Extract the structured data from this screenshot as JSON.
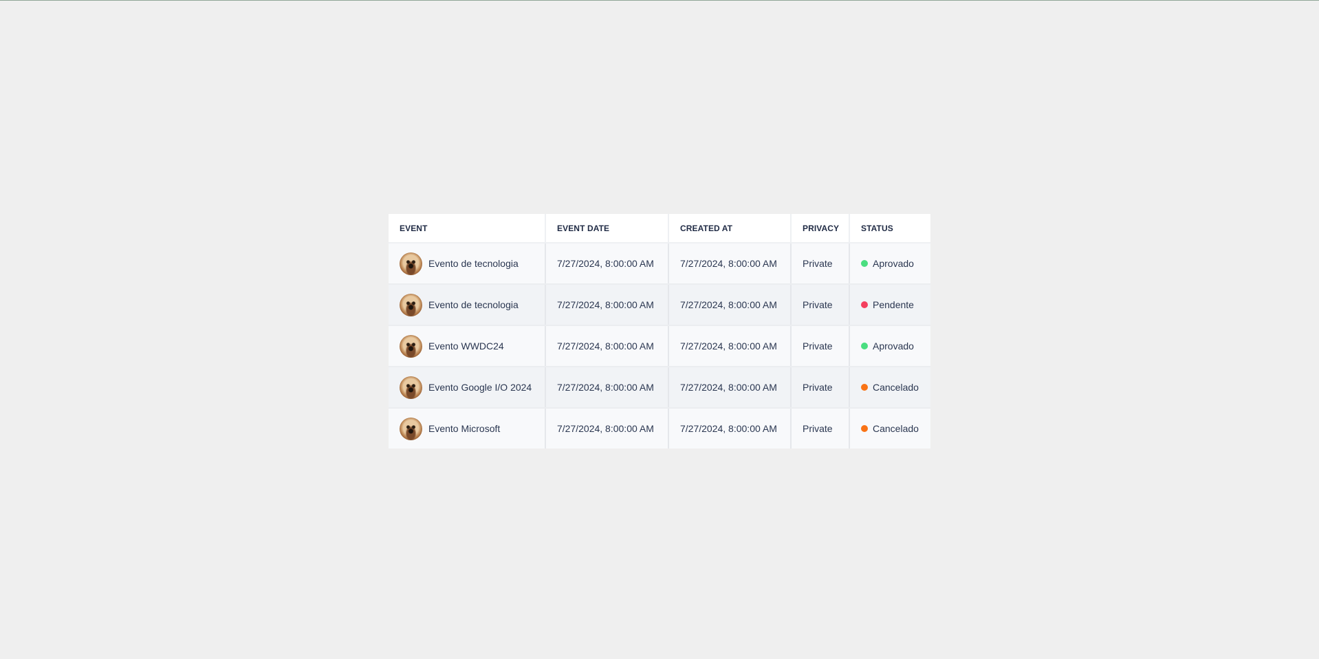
{
  "table": {
    "headers": {
      "event": "EVENT",
      "event_date": "EVENT DATE",
      "created_at": "CREATED AT",
      "privacy": "PRIVACY",
      "status": "STATUS"
    },
    "rows": [
      {
        "event": "Evento de tecnologia",
        "event_date": "7/27/2024, 8:00:00 AM",
        "created_at": "7/27/2024, 8:00:00 AM",
        "privacy": "Private",
        "status": "Aprovado",
        "status_color": "#4ade80",
        "avatar_icon": "dog-avatar"
      },
      {
        "event": "Evento de tecnologia",
        "event_date": "7/27/2024, 8:00:00 AM",
        "created_at": "7/27/2024, 8:00:00 AM",
        "privacy": "Private",
        "status": "Pendente",
        "status_color": "#f43f5e",
        "avatar_icon": "dog-avatar"
      },
      {
        "event": "Evento WWDC24",
        "event_date": "7/27/2024, 8:00:00 AM",
        "created_at": "7/27/2024, 8:00:00 AM",
        "privacy": "Private",
        "status": "Aprovado",
        "status_color": "#4ade80",
        "avatar_icon": "dog-avatar"
      },
      {
        "event": "Evento Google I/O 2024",
        "event_date": "7/27/2024, 8:00:00 AM",
        "created_at": "7/27/2024, 8:00:00 AM",
        "privacy": "Private",
        "status": "Cancelado",
        "status_color": "#f97316",
        "avatar_icon": "dog-avatar"
      },
      {
        "event": "Evento Microsoft",
        "event_date": "7/27/2024, 8:00:00 AM",
        "created_at": "7/27/2024, 8:00:00 AM",
        "privacy": "Private",
        "status": "Cancelado",
        "status_color": "#f97316",
        "avatar_icon": "dog-avatar"
      }
    ]
  }
}
